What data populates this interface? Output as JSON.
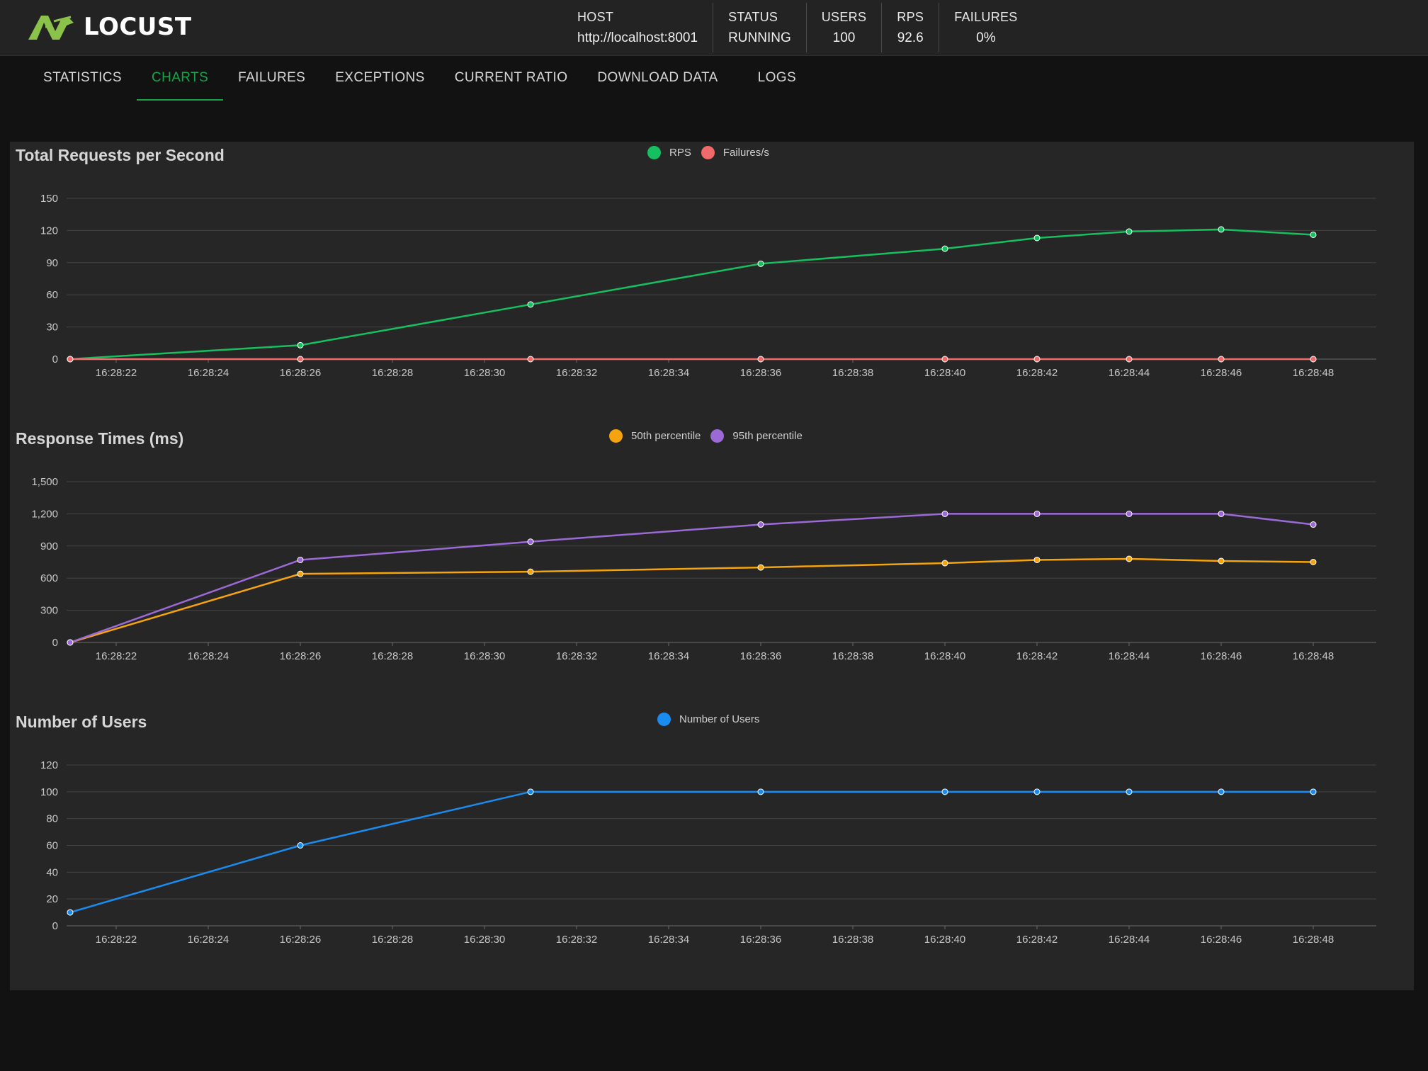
{
  "app": {
    "name": "LOCUST"
  },
  "header": {
    "stats": [
      {
        "label": "HOST",
        "value": "http://localhost:8001"
      },
      {
        "label": "STATUS",
        "value": "RUNNING"
      },
      {
        "label": "USERS",
        "value": "100"
      },
      {
        "label": "RPS",
        "value": "92.6"
      },
      {
        "label": "FAILURES",
        "value": "0%"
      }
    ]
  },
  "tabs": [
    {
      "label": "STATISTICS",
      "active": false
    },
    {
      "label": "CHARTS",
      "active": true
    },
    {
      "label": "FAILURES",
      "active": false
    },
    {
      "label": "EXCEPTIONS",
      "active": false
    },
    {
      "label": "CURRENT RATIO",
      "active": false
    },
    {
      "label": "DOWNLOAD DATA",
      "active": false
    },
    {
      "label": "LOGS",
      "active": false
    }
  ],
  "colors": {
    "accent": "#16a34a",
    "rps": "#16c060",
    "failures": "#f06a6a",
    "p50": "#f5a30f",
    "p95": "#9b6ad6",
    "users": "#1a8cf0"
  },
  "chart_data": [
    {
      "type": "line",
      "title": "Total Requests per Second",
      "x": [
        "16:28:21",
        "16:28:26",
        "16:28:31",
        "16:28:36",
        "16:28:40",
        "16:28:42",
        "16:28:44",
        "16:28:46",
        "16:28:48"
      ],
      "x_ticks": [
        "16:28:22",
        "16:28:24",
        "16:28:26",
        "16:28:28",
        "16:28:30",
        "16:28:32",
        "16:28:34",
        "16:28:36",
        "16:28:38",
        "16:28:40",
        "16:28:42",
        "16:28:44",
        "16:28:46",
        "16:28:48"
      ],
      "ylim": [
        0,
        150
      ],
      "y_ticks": [
        "0",
        "30",
        "60",
        "90",
        "120",
        "150"
      ],
      "series": [
        {
          "name": "RPS",
          "color": "#16c060",
          "values": [
            0,
            13,
            51,
            89,
            103,
            113,
            119,
            121,
            116
          ]
        },
        {
          "name": "Failures/s",
          "color": "#f06a6a",
          "values": [
            0,
            0,
            0,
            0,
            0,
            0,
            0,
            0,
            0
          ]
        }
      ],
      "legend_position": "top-center",
      "grid": true
    },
    {
      "type": "line",
      "title": "Response Times (ms)",
      "x": [
        "16:28:21",
        "16:28:26",
        "16:28:31",
        "16:28:36",
        "16:28:40",
        "16:28:42",
        "16:28:44",
        "16:28:46",
        "16:28:48"
      ],
      "x_ticks": [
        "16:28:22",
        "16:28:24",
        "16:28:26",
        "16:28:28",
        "16:28:30",
        "16:28:32",
        "16:28:34",
        "16:28:36",
        "16:28:38",
        "16:28:40",
        "16:28:42",
        "16:28:44",
        "16:28:46",
        "16:28:48"
      ],
      "ylim": [
        0,
        1500
      ],
      "y_ticks": [
        "0",
        "300",
        "600",
        "900",
        "1,200",
        "1,500"
      ],
      "series": [
        {
          "name": "50th percentile",
          "color": "#f5a30f",
          "values": [
            0,
            640,
            660,
            700,
            740,
            770,
            780,
            760,
            750
          ]
        },
        {
          "name": "95th percentile",
          "color": "#9b6ad6",
          "values": [
            0,
            770,
            940,
            1100,
            1200,
            1200,
            1200,
            1200,
            1100
          ]
        }
      ],
      "legend_position": "top-center",
      "grid": true
    },
    {
      "type": "line",
      "title": "Number of Users",
      "x": [
        "16:28:21",
        "16:28:26",
        "16:28:31",
        "16:28:36",
        "16:28:40",
        "16:28:42",
        "16:28:44",
        "16:28:46",
        "16:28:48"
      ],
      "x_ticks": [
        "16:28:22",
        "16:28:24",
        "16:28:26",
        "16:28:28",
        "16:28:30",
        "16:28:32",
        "16:28:34",
        "16:28:36",
        "16:28:38",
        "16:28:40",
        "16:28:42",
        "16:28:44",
        "16:28:46",
        "16:28:48"
      ],
      "ylim": [
        0,
        120
      ],
      "y_ticks": [
        "0",
        "20",
        "40",
        "60",
        "80",
        "100",
        "120"
      ],
      "series": [
        {
          "name": "Number of Users",
          "color": "#1a8cf0",
          "values": [
            10,
            60,
            100,
            100,
            100,
            100,
            100,
            100,
            100
          ]
        }
      ],
      "legend_position": "top-center",
      "grid": true
    }
  ]
}
